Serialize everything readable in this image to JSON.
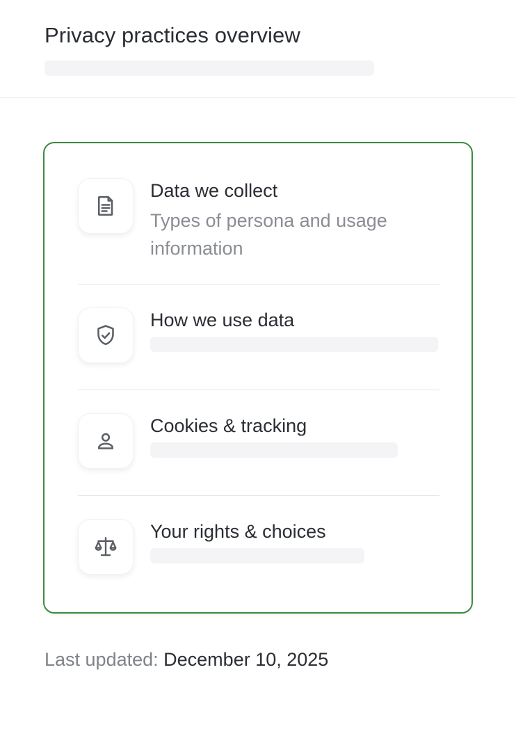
{
  "header": {
    "title": "Privacy practices overview"
  },
  "items": [
    {
      "icon": "document-icon",
      "title": "Data we collect",
      "description": "Types of persona and usage information"
    },
    {
      "icon": "shield-check-icon",
      "title": "How we use data"
    },
    {
      "icon": "person-icon",
      "title": "Cookies & tracking"
    },
    {
      "icon": "scale-icon",
      "title": "Your rights & choices"
    }
  ],
  "footer": {
    "label": "Last updated:",
    "date": "December 10, 2025"
  },
  "colors": {
    "card_border": "#3d8a3f",
    "text": "#2a2d33",
    "muted_text": "#8a8d93",
    "placeholder": "#f4f4f6"
  }
}
